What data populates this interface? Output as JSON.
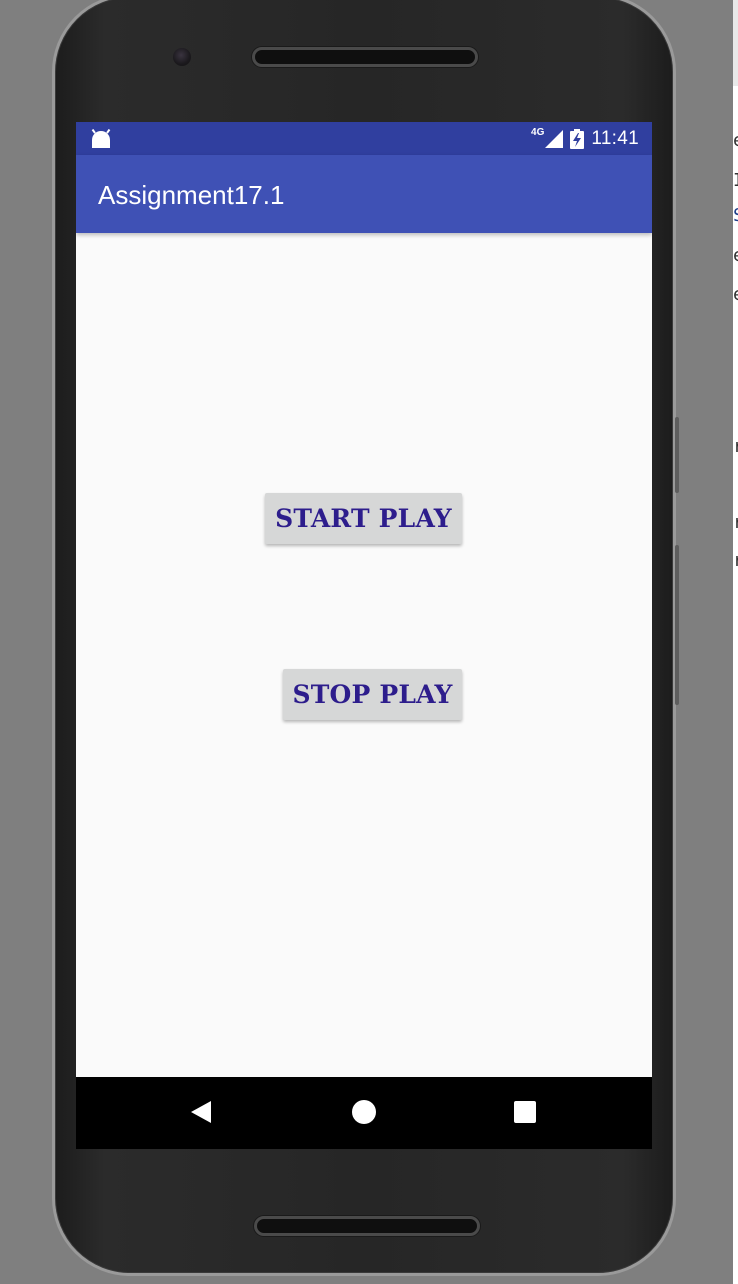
{
  "app": {
    "title": "Assignment17.1"
  },
  "status_bar": {
    "time": "11:41",
    "network": "4G",
    "icons": [
      "android-notification-icon",
      "signal-icon",
      "battery-charging-icon"
    ]
  },
  "buttons": {
    "start_label": "START PLAY",
    "stop_label": "STOP PLAY"
  },
  "nav": {
    "icons": [
      "back-icon",
      "home-icon",
      "recents-icon"
    ]
  },
  "background_doc": {
    "line_glyphs": [
      "e",
      "I",
      "S",
      "e",
      "e",
      "r",
      "r",
      "r"
    ]
  },
  "colors": {
    "status_bar": "#303f9f",
    "app_bar": "#3f51b5",
    "button_bg": "#d6d7d7",
    "button_text": "#2d1d8c",
    "screen_bg": "#fafafa",
    "nav_bar": "#000000"
  }
}
